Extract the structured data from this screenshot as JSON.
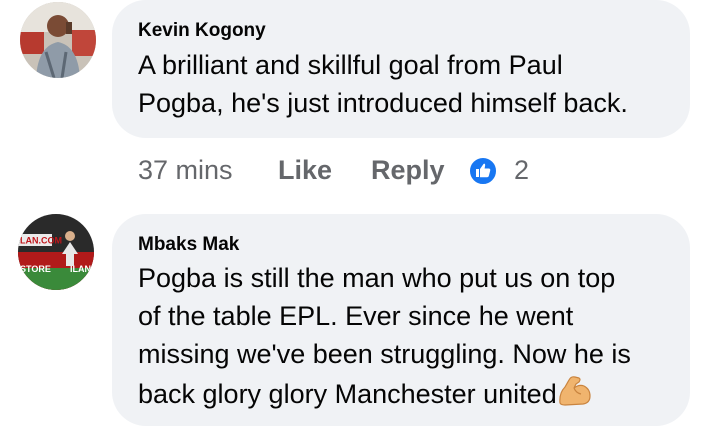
{
  "comments": [
    {
      "author": "Kevin Kogony",
      "text_lines": [
        "A brilliant and skillful goal from Paul",
        "Pogba, he's just introduced himself back."
      ],
      "time": "37 mins",
      "like_label": "Like",
      "reply_label": "Reply",
      "reaction_icon": "thumbs-up-icon",
      "reaction_count": "2"
    },
    {
      "author": "Mbaks Mak",
      "avatar_text_top": "LAN.COM",
      "avatar_text_bottom": "STORE",
      "avatar_text_bottom2": "ILAN",
      "text_lines": [
        "Pogba is still the man who put us on top",
        "of the table EPL. Ever since he went",
        "missing we've been struggling. Now he is",
        "back glory glory Manchester united"
      ],
      "trailing_icon": "flexed-biceps-icon"
    }
  ],
  "colors": {
    "bubble": "#f0f2f5",
    "meta": "#65676b",
    "like_blue": "#1877f2"
  }
}
